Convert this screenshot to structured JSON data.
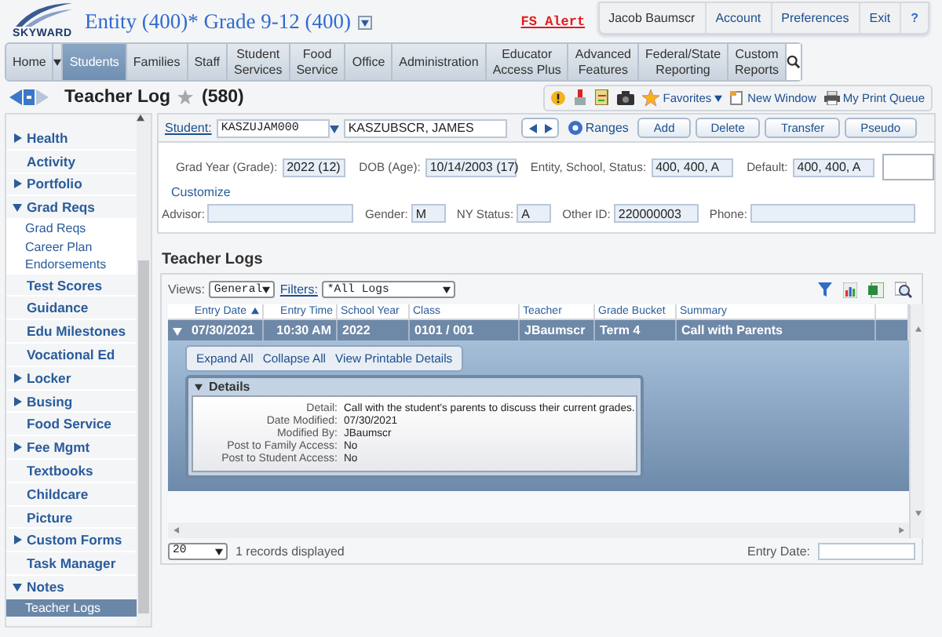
{
  "header": {
    "logo": "SKYWARD",
    "entity": "Entity (400)* Grade 9-12 (400)",
    "alert": "FS Alert",
    "user_menu": [
      "Jacob Baumscr",
      "Account",
      "Preferences",
      "Exit",
      "?"
    ]
  },
  "nav": [
    {
      "label": "Home",
      "selected": false
    },
    {
      "label": "Students",
      "selected": true
    },
    {
      "label": "Families",
      "selected": false
    },
    {
      "label": "Staff",
      "selected": false
    },
    {
      "label": "Student\nServices",
      "selected": false
    },
    {
      "label": "Food\nService",
      "selected": false
    },
    {
      "label": "Office",
      "selected": false
    },
    {
      "label": "Administration",
      "selected": false
    },
    {
      "label": "Educator\nAccess Plus",
      "selected": false
    },
    {
      "label": "Advanced\nFeatures",
      "selected": false
    },
    {
      "label": "Federal/State\nReporting",
      "selected": false
    },
    {
      "label": "Custom\nReports",
      "selected": false
    }
  ],
  "page": {
    "title": "Teacher Log",
    "count": "(580)",
    "toolbar": {
      "favorites": "Favorites",
      "new_window": "New Window",
      "print_queue": "My Print Queue"
    }
  },
  "sidebar": [
    {
      "label": "Health",
      "kind": "group",
      "expanded": false,
      "selected": false
    },
    {
      "label": "Activity",
      "kind": "link",
      "selected": false
    },
    {
      "label": "Portfolio",
      "kind": "group",
      "expanded": false,
      "selected": false
    },
    {
      "label": "Grad Reqs",
      "kind": "group",
      "expanded": true,
      "selected": false,
      "children": [
        {
          "label": "Grad Reqs",
          "selected": false
        },
        {
          "label": "Career Plan",
          "selected": false
        },
        {
          "label": "Endorsements",
          "selected": false
        }
      ]
    },
    {
      "label": "Test Scores",
      "kind": "link",
      "selected": false
    },
    {
      "label": "Guidance",
      "kind": "link",
      "selected": false
    },
    {
      "label": "Edu Milestones",
      "kind": "link",
      "selected": false
    },
    {
      "label": "Vocational Ed",
      "kind": "link",
      "selected": false
    },
    {
      "label": "Locker",
      "kind": "group",
      "expanded": false,
      "selected": false
    },
    {
      "label": "Busing",
      "kind": "group",
      "expanded": false,
      "selected": false
    },
    {
      "label": "Food Service",
      "kind": "link",
      "selected": false
    },
    {
      "label": "Fee Mgmt",
      "kind": "group",
      "expanded": false,
      "selected": false
    },
    {
      "label": "Textbooks",
      "kind": "link",
      "selected": false
    },
    {
      "label": "Childcare",
      "kind": "link",
      "selected": false
    },
    {
      "label": "Picture",
      "kind": "link",
      "selected": false
    },
    {
      "label": "Custom Forms",
      "kind": "group",
      "expanded": false,
      "selected": false
    },
    {
      "label": "Task Manager",
      "kind": "link",
      "selected": false
    },
    {
      "label": "Notes",
      "kind": "group",
      "expanded": true,
      "selected": false,
      "children": [
        {
          "label": "Teacher Logs",
          "selected": true
        }
      ]
    }
  ],
  "student": {
    "link": "Student:",
    "id": "KASZUJAM000",
    "name": "KASZUBSCR, JAMES",
    "ranges": "Ranges",
    "buttons": [
      "Add",
      "Delete",
      "Transfer",
      "Pseudo"
    ],
    "row1": [
      {
        "label": "Grad Year (Grade):",
        "value": "2022 (12)"
      },
      {
        "label": "DOB (Age):",
        "value": "10/14/2003 (17)"
      },
      {
        "label": "Entity, School, Status:",
        "value": "400, 400, A"
      },
      {
        "label": "Default:",
        "value": "400, 400, A"
      }
    ],
    "customize": "Customize",
    "row2": [
      {
        "label": "Advisor:"
      },
      {
        "label": "Gender:",
        "value": "M"
      },
      {
        "label": "NY Status:",
        "value": "A"
      },
      {
        "label": "Other ID:",
        "value": "220000003"
      },
      {
        "label": "Phone:"
      }
    ]
  },
  "logs": {
    "heading": "Teacher Logs",
    "views_label": "Views:",
    "views": "General",
    "filters_label": "Filters:",
    "filters": "*All Logs",
    "columns": [
      "Entry Date",
      "Entry Time",
      "School Year",
      "Class",
      "Teacher",
      "Grade Bucket",
      "Summary"
    ],
    "rows": [
      {
        "cells": [
          "07/30/2021",
          "10:30 AM",
          "2022",
          "0101 / 001",
          "JBaumscr",
          "Term 4",
          "Call with Parents"
        ],
        "selected": true,
        "expanded": true
      }
    ],
    "actions": [
      "Expand All",
      "Collapse All",
      "View Printable Details"
    ],
    "details": {
      "title": "Details",
      "expanded": true,
      "fields": [
        {
          "label": "Detail:",
          "value": "Call with the student's parents to discuss their current grades."
        },
        {
          "label": "Date Modified:",
          "value": "07/30/2021"
        },
        {
          "label": "Modified By:",
          "value": "JBaumscr"
        },
        {
          "label": "Post to Family Access:",
          "value": "No"
        },
        {
          "label": "Post to Student Access:",
          "value": "No"
        }
      ]
    },
    "page_size": "20",
    "records": "1 records displayed",
    "entry_date_label": "Entry Date:"
  }
}
